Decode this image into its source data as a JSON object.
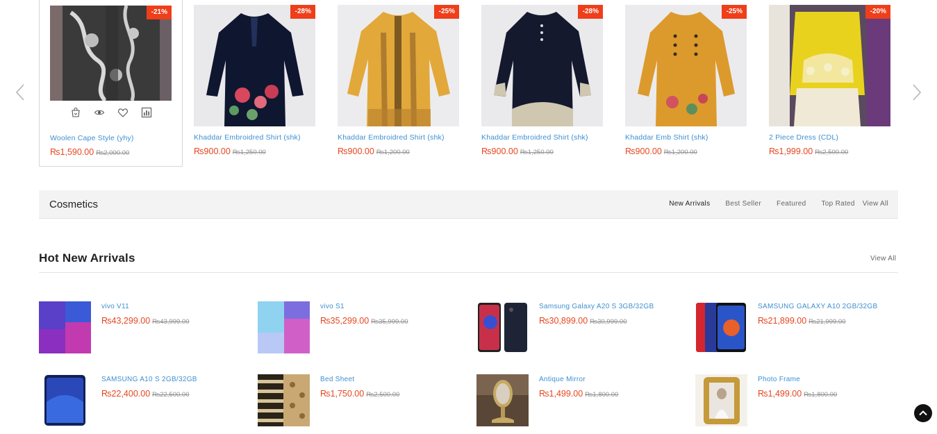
{
  "carousel": {
    "products": [
      {
        "name": "Woolen Cape Style (yhy)",
        "price": "₨1,590.00",
        "old_price": "₨2,000.00",
        "discount": "-21%"
      },
      {
        "name": "Khaddar Embroidred Shirt (shk)",
        "price": "₨900.00",
        "old_price": "₨1,250.00",
        "discount": "-28%"
      },
      {
        "name": "Khaddar Embroidred Shirt (shk)",
        "price": "₨900.00",
        "old_price": "₨1,200.00",
        "discount": "-25%"
      },
      {
        "name": "Khaddar Embroidred Shirt (shk)",
        "price": "₨900.00",
        "old_price": "₨1,250.00",
        "discount": "-28%"
      },
      {
        "name": "Khaddar Emb Shirt (shk)",
        "price": "₨900.00",
        "old_price": "₨1,200.00",
        "discount": "-25%"
      },
      {
        "name": "2 Piece Dress (CDL)",
        "price": "₨1,999.00",
        "old_price": "₨2,500.00",
        "discount": "-20%"
      }
    ],
    "actions": [
      "cart-icon",
      "eye-icon",
      "heart-icon",
      "compare-icon"
    ]
  },
  "cosmetics": {
    "title": "Cosmetics",
    "tabs": [
      "New Arrivals",
      "Best Seller",
      "Featured",
      "Top Rated"
    ],
    "view_all": "View All"
  },
  "hot_new_arrivals": {
    "title": "Hot New Arrivals",
    "view_all": "View All",
    "items": [
      {
        "name": "vivo V11",
        "price": "₨43,299.00",
        "old_price": "₨43,999.00"
      },
      {
        "name": "vivo S1",
        "price": "₨35,299.00",
        "old_price": "₨35,999.00"
      },
      {
        "name": "Samsung Galaxy A20 S 3GB/32GB",
        "price": "₨30,899.00",
        "old_price": "₨30,999.00"
      },
      {
        "name": "SAMSUNG GALAXY A10 2GB/32GB",
        "price": "₨21,899.00",
        "old_price": "₨21,999.00"
      },
      {
        "name": "SAMSUNG A10 S 2GB/32GB",
        "price": "₨22,400.00",
        "old_price": "₨22,500.00"
      },
      {
        "name": "Bed Sheet",
        "price": "₨1,750.00",
        "old_price": "₨2,500.00"
      },
      {
        "name": "Antique Mirror",
        "price": "₨1,499.00",
        "old_price": "₨1,800.00"
      },
      {
        "name": "Photo Frame",
        "price": "₨1,499.00",
        "old_price": "₨1,800.00"
      }
    ]
  },
  "colors": {
    "accent_price": "#e6461f",
    "badge": "#ef3e1a",
    "link": "#3d8fd1"
  }
}
